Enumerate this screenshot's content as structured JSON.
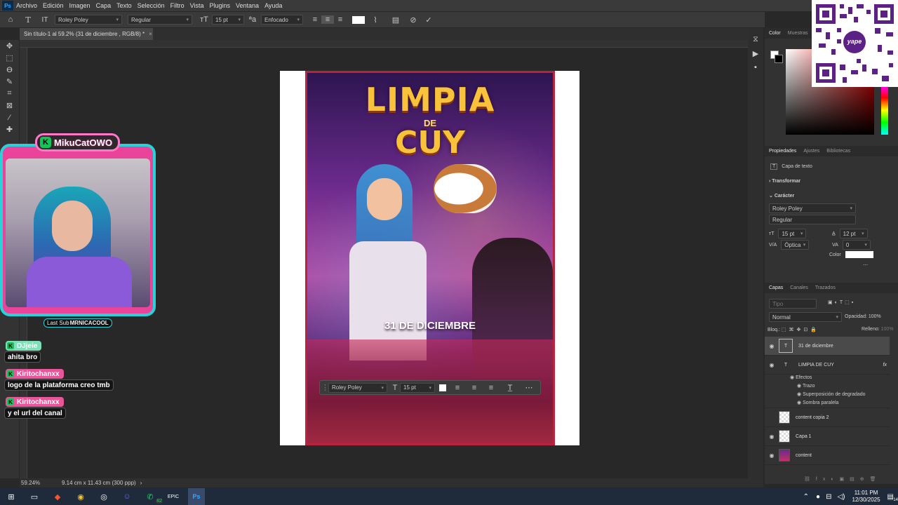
{
  "menubar": {
    "app_icon": "Ps",
    "items": [
      "Archivo",
      "Edición",
      "Imagen",
      "Capa",
      "Texto",
      "Selección",
      "Filtro",
      "Vista",
      "Plugins",
      "Ventana",
      "Ayuda"
    ]
  },
  "options": {
    "font_family": "Roley Poley",
    "font_style": "Regular",
    "font_size": "15 pt",
    "antialias": "Enfocado"
  },
  "document": {
    "tab_title": "Sin título-1 al 59.2% (31 de diciembre , RGB/8) *",
    "close": "×",
    "zoom": "59.24%",
    "size_info": "9.14 cm x 11.43 cm (300 ppp)"
  },
  "poster": {
    "title_line1": "LIMPIA",
    "title_de": "DE",
    "title_line2": "CUY",
    "date_text": "31 DE DICIEMBRE"
  },
  "floating_bar": {
    "font": "Roley Poley",
    "size": "15 pt"
  },
  "color_panel": {
    "tabs": [
      "Color",
      "Muestras"
    ]
  },
  "properties": {
    "tabs": [
      "Propiedades",
      "Ajustes",
      "Bibliotecas"
    ],
    "layer_type": "Capa de texto",
    "transform_label": "Transformar",
    "character_label": "Carácter",
    "font": "Roley Poley",
    "style": "Regular",
    "size": "15 pt",
    "leading": "12 pt",
    "kerning": "Óptica",
    "tracking": "0",
    "color_label": "Color"
  },
  "layers": {
    "tabs": [
      "Capas",
      "Canales",
      "Trazados"
    ],
    "search_placeholder": "Tipo",
    "blend_mode": "Normal",
    "opacity_label": "Opacidad:",
    "opacity": "100%",
    "lock_label": "Bloq.:",
    "fill_label": "Relleno:",
    "fill": "100%",
    "items": [
      {
        "name": "31 de diciembre",
        "kind": "text"
      },
      {
        "name": "LIMPIA DE CUY",
        "kind": "text",
        "fx": "fx"
      },
      {
        "name": "content copia 2",
        "kind": "raster"
      },
      {
        "name": "Capa 1",
        "kind": "raster"
      },
      {
        "name": "content",
        "kind": "image"
      }
    ],
    "effects_label": "Efectos",
    "effects": [
      "Trazo",
      "Superposición de degradado",
      "Sombra paralela"
    ]
  },
  "stream": {
    "streamer_name": "MikuCatOWO",
    "last_sub_label": "Last Sub",
    "last_sub_name": "MRNICACOOL",
    "chat": [
      {
        "user": "DJjeie",
        "message": "ahita bro",
        "color": "#7de0b8"
      },
      {
        "user": "Kiritochanxx",
        "message": "logo de la plataforma creo tmb",
        "color": "#e8559a"
      },
      {
        "user": "Kiritochanxx",
        "message": "y el url del canal",
        "color": "#e8559a"
      }
    ]
  },
  "qr": {
    "brand_text": "yape"
  },
  "taskbar": {
    "time": "11:01 PM",
    "date": "12/30/2025",
    "badge": "82",
    "notif": "14"
  },
  "colors": {
    "accent_cyan": "#27d3d8",
    "accent_pink": "#e9449a",
    "title_yellow": "#f8c23a"
  }
}
